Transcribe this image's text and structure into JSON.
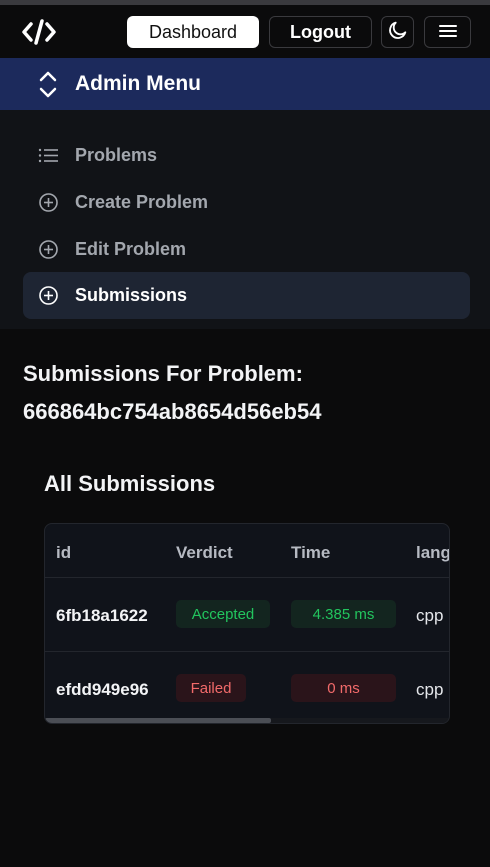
{
  "header": {
    "dashboard_label": "Dashboard",
    "logout_label": "Logout"
  },
  "admin_menu": {
    "title": "Admin Menu",
    "items": [
      {
        "label": "Problems",
        "icon": "list-icon"
      },
      {
        "label": "Create Problem",
        "icon": "plus-circle-icon"
      },
      {
        "label": "Edit Problem",
        "icon": "plus-circle-icon"
      },
      {
        "label": "Submissions",
        "icon": "plus-circle-icon",
        "active": true
      }
    ]
  },
  "page": {
    "heading_line1": "Submissions For Problem:",
    "heading_line2": "666864bc754ab8654d56eb54",
    "section_title": "All Submissions"
  },
  "table": {
    "columns": [
      "id",
      "Verdict",
      "Time",
      "lang"
    ],
    "rows": [
      {
        "id": "6fb18a1622",
        "verdict": "Accepted",
        "time": "4.385 ms",
        "lang": "cpp"
      },
      {
        "id": "efdd949e96",
        "verdict": "Failed",
        "time": "0 ms",
        "lang": "cpp"
      }
    ]
  },
  "colors": {
    "admin_bar": "#1c2a5c",
    "accepted": "#22c55e",
    "failed": "#f16a6a"
  }
}
